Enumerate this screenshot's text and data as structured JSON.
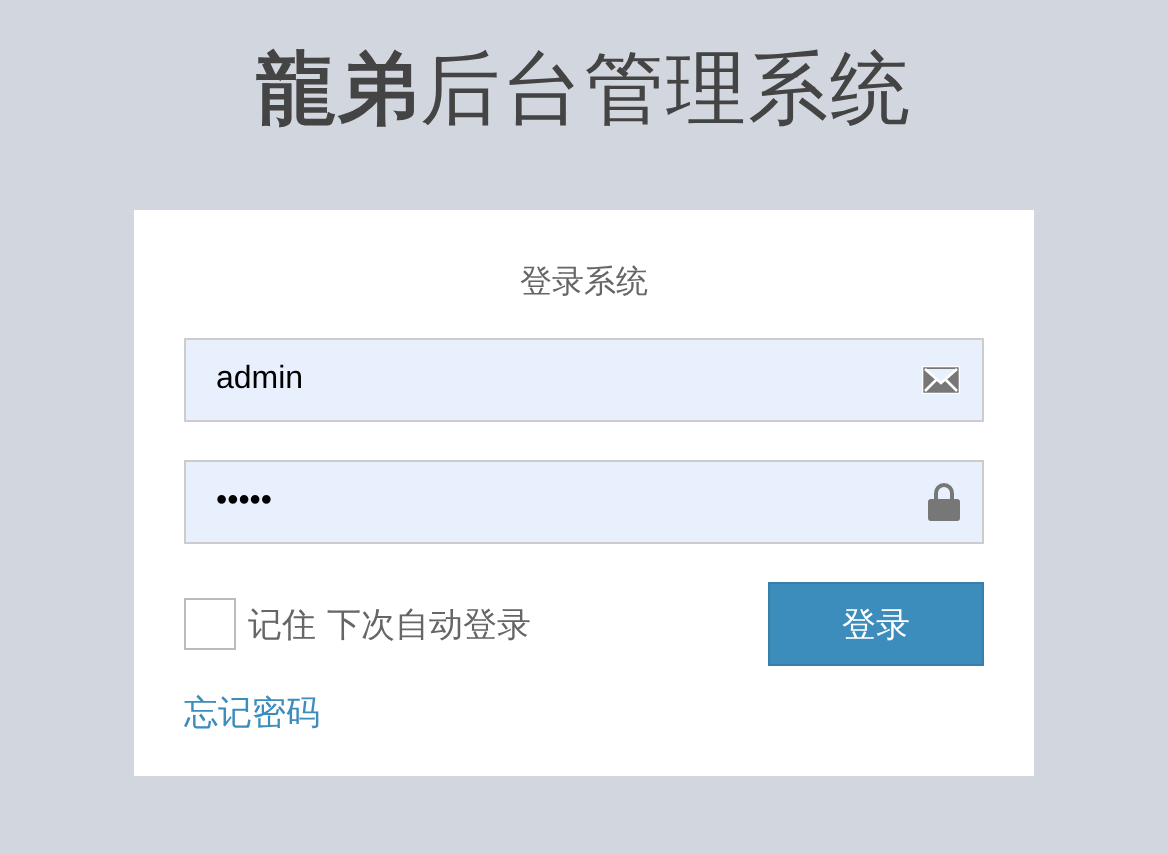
{
  "title": "**龍弟**后台管理系统",
  "login": {
    "heading": "登录系统",
    "username": {
      "value": "admin"
    },
    "password": {
      "value": "•••••"
    },
    "remember": {
      "label": "记住 下次自动登录",
      "checked": false
    },
    "submit": "登录",
    "forgot": "忘记密码"
  }
}
